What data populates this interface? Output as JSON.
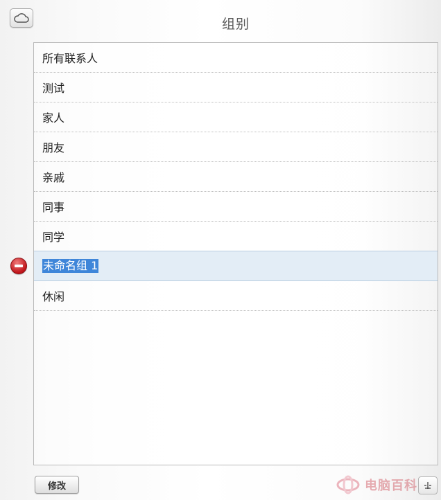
{
  "header": {
    "title": "组别",
    "cloud_icon": "cloud-icon"
  },
  "groups": {
    "items": [
      {
        "label": "所有联系人"
      },
      {
        "label": "测试"
      },
      {
        "label": "家人"
      },
      {
        "label": "朋友"
      },
      {
        "label": "亲戚"
      },
      {
        "label": "同事"
      },
      {
        "label": "同学"
      },
      {
        "label": "未命名组 1",
        "editing": true
      },
      {
        "label": "休闲"
      }
    ],
    "selected_index": 7,
    "delete_icon": "minus-circle-icon"
  },
  "footer": {
    "edit_label": "修改",
    "resize_icon": "resize-grip-icon",
    "watermark_text": "电脑百科"
  },
  "colors": {
    "selection_highlight": "#3f86d9",
    "selected_row_bg": "#e3edf6",
    "delete_red": "#c0151a"
  }
}
